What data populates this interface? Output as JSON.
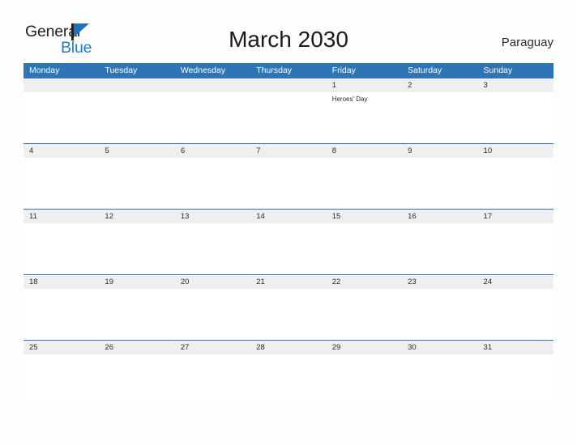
{
  "logo": {
    "word_one": "General",
    "word_two": "Blue",
    "flag_icon": "flag-triangle-icon",
    "color_dark": "#231f20",
    "color_blue": "#1f7fc4"
  },
  "header": {
    "title": "March 2030",
    "country": "Paraguay"
  },
  "theme": {
    "header_blue": "#2e75b6",
    "row_divider_blue": "#2e75b6",
    "daynum_band_gray": "#efefef",
    "page_background": "#fdfdfd",
    "text_dark": "#2b2b2b"
  },
  "weekdays": [
    "Monday",
    "Tuesday",
    "Wednesday",
    "Thursday",
    "Friday",
    "Saturday",
    "Sunday"
  ],
  "weeks": [
    [
      {
        "date": "",
        "event": ""
      },
      {
        "date": "",
        "event": ""
      },
      {
        "date": "",
        "event": ""
      },
      {
        "date": "",
        "event": ""
      },
      {
        "date": "1",
        "event": "Heroes' Day"
      },
      {
        "date": "2",
        "event": ""
      },
      {
        "date": "3",
        "event": ""
      }
    ],
    [
      {
        "date": "4",
        "event": ""
      },
      {
        "date": "5",
        "event": ""
      },
      {
        "date": "6",
        "event": ""
      },
      {
        "date": "7",
        "event": ""
      },
      {
        "date": "8",
        "event": ""
      },
      {
        "date": "9",
        "event": ""
      },
      {
        "date": "10",
        "event": ""
      }
    ],
    [
      {
        "date": "11",
        "event": ""
      },
      {
        "date": "12",
        "event": ""
      },
      {
        "date": "13",
        "event": ""
      },
      {
        "date": "14",
        "event": ""
      },
      {
        "date": "15",
        "event": ""
      },
      {
        "date": "16",
        "event": ""
      },
      {
        "date": "17",
        "event": ""
      }
    ],
    [
      {
        "date": "18",
        "event": ""
      },
      {
        "date": "19",
        "event": ""
      },
      {
        "date": "20",
        "event": ""
      },
      {
        "date": "21",
        "event": ""
      },
      {
        "date": "22",
        "event": ""
      },
      {
        "date": "23",
        "event": ""
      },
      {
        "date": "24",
        "event": ""
      }
    ],
    [
      {
        "date": "25",
        "event": ""
      },
      {
        "date": "26",
        "event": ""
      },
      {
        "date": "27",
        "event": ""
      },
      {
        "date": "28",
        "event": ""
      },
      {
        "date": "29",
        "event": ""
      },
      {
        "date": "30",
        "event": ""
      },
      {
        "date": "31",
        "event": ""
      }
    ]
  ]
}
